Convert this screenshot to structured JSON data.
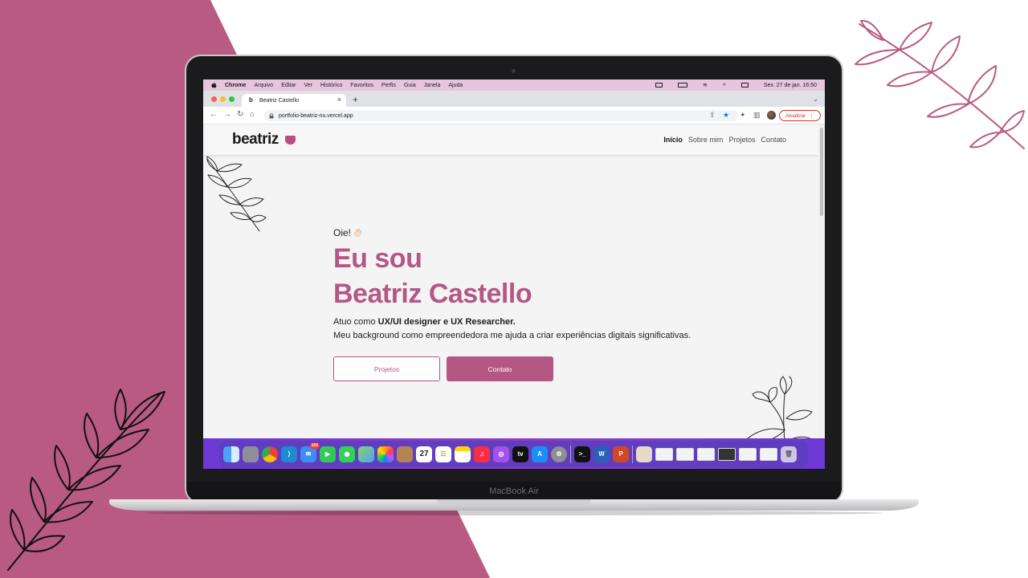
{
  "colors": {
    "brand": "#b55785",
    "background_shape": "#b85a82",
    "menubar": "#e7c5dd",
    "dock": "#6b3ad3",
    "update_red": "#d93025"
  },
  "laptop": {
    "model_label": "MacBook Air"
  },
  "menubar": {
    "apple_icon": "apple-icon",
    "items": [
      "Chrome",
      "Arquivo",
      "Editar",
      "Ver",
      "Histórico",
      "Favoritos",
      "Perfis",
      "Guia",
      "Janela",
      "Ajuda"
    ],
    "datetime": "Sex. 27 de jan.  16:50"
  },
  "browser": {
    "tab_title": "Beatriz Castello",
    "tab_close": "×",
    "new_tab": "+",
    "url": "portfolio-beatriz-nu.vercel.app",
    "update_label": "Atualizar",
    "update_menu": "⋮"
  },
  "site": {
    "logo": "beatriz",
    "nav": [
      "Início",
      "Sobre mim",
      "Projetos",
      "Contato"
    ],
    "greeting": "Oie!",
    "hero_line1": "Eu sou",
    "hero_line2": "Beatriz Castello",
    "intro_prefix": "Atuo como ",
    "intro_bold": "UX/UI designer e UX Researcher.",
    "intro_line2": "Meu background como empreendedora me ajuda a criar experiências digitais significativas.",
    "button_projects": "Projetos",
    "button_contact": "Contato"
  },
  "dock": {
    "calendar_day": "27",
    "mail_badge": "102",
    "apps": [
      "finder-icon",
      "launchpad-icon",
      "chrome-icon",
      "vscode-icon",
      "mail-icon",
      "facetime-icon",
      "messages-icon",
      "maps-icon",
      "photos-icon",
      "contacts-icon",
      "calendar-icon",
      "reminders-icon",
      "notes-icon",
      "music-icon",
      "podcasts-icon",
      "tv-icon",
      "appstore-icon",
      "settings-icon",
      "terminal-icon",
      "word-icon",
      "powerpoint-icon",
      "trash-icon"
    ]
  }
}
